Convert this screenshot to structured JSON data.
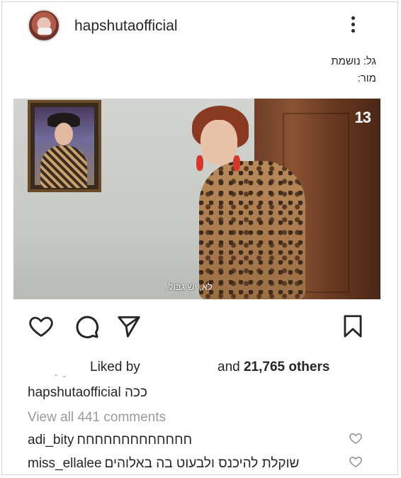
{
  "header": {
    "username": "hapshutaofficial"
  },
  "caption_lines": [
    "גל: נושמת",
    "מור:"
  ],
  "media": {
    "channel_logo": "13",
    "subtitle": "לא, יש גבול."
  },
  "icons": {
    "like": "heart-icon",
    "comment": "comment-bubble-icon",
    "share": "paper-plane-icon",
    "save": "bookmark-icon",
    "more": "more-options-icon"
  },
  "likes": {
    "liked_by": "Liked by",
    "and": "and",
    "others": "21,765 others"
  },
  "post_caption": {
    "username": "hapshutaofficial",
    "text": "ככה"
  },
  "view_all": "View all 441 comments",
  "comments": [
    {
      "username": "adi_bity",
      "text": "חחחחחחחחחחחחח"
    },
    {
      "username": "miss_ellalee",
      "text": "שוקלת להיכנס ולבעוט בה באלוהים"
    }
  ],
  "colors": {
    "text": "#262626",
    "muted": "#9a9a9a"
  }
}
